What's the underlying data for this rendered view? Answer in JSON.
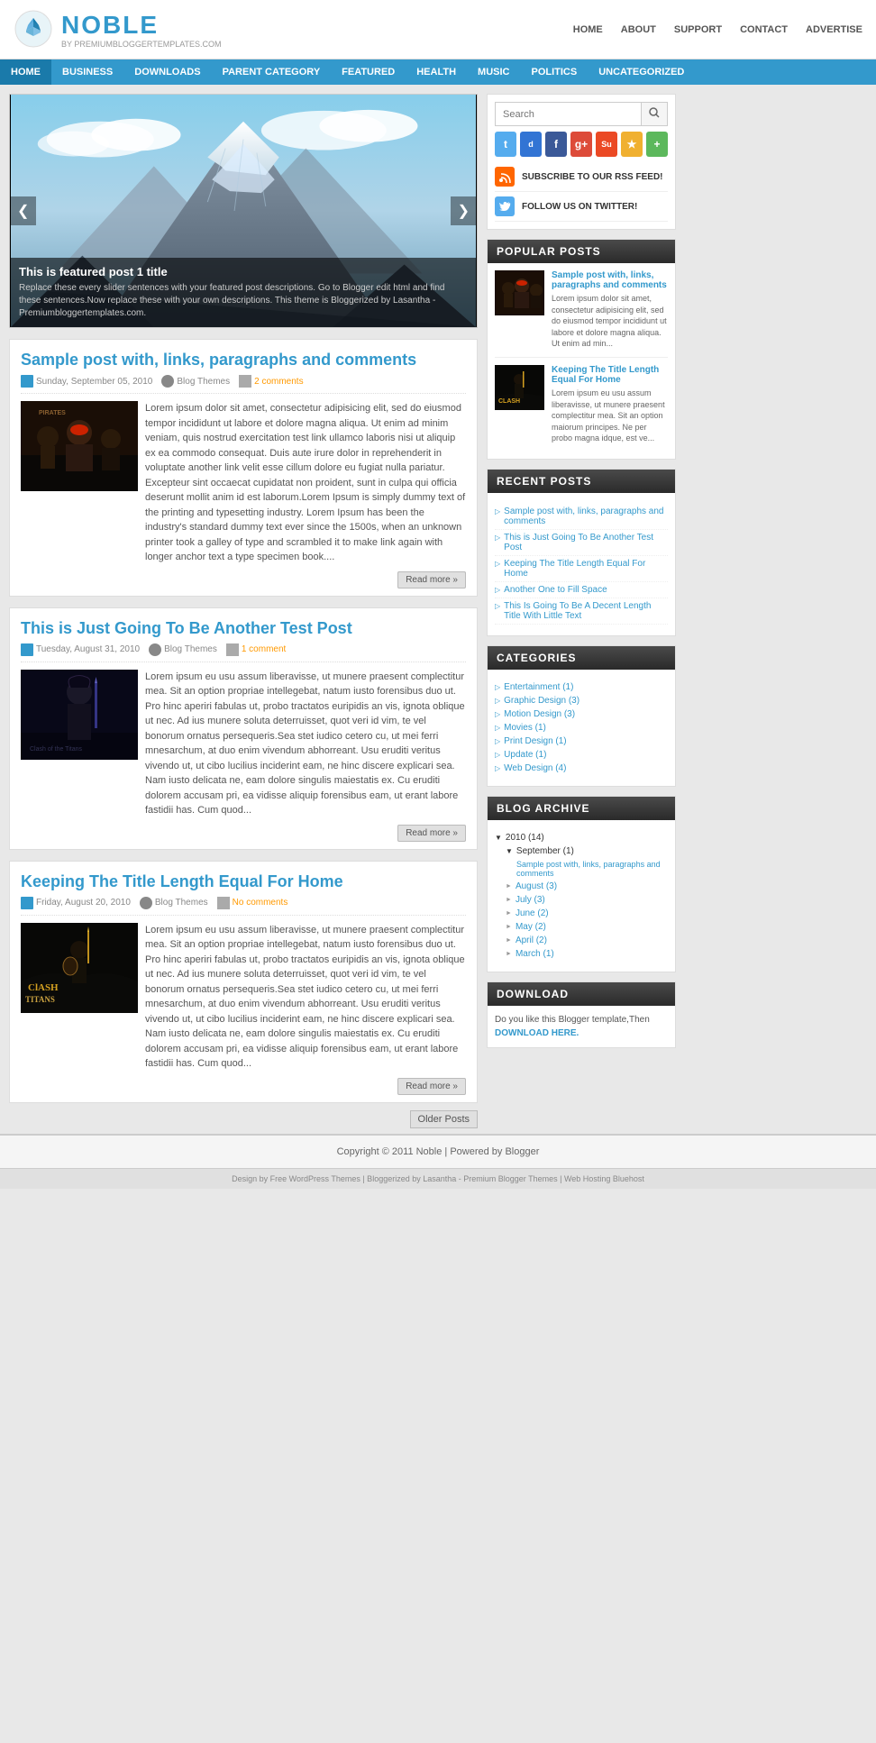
{
  "site": {
    "logo_title": "NOBLE",
    "logo_sub": "BY PREMIUMBLOGGERTEMPLATES.COM",
    "copyright": "Copyright © 2011 Noble | Powered by Blogger",
    "footer_bottom": "Design by Free WordPress Themes | Bloggerized by Lasantha - Premium Blogger Themes | Web Hosting Bluehost"
  },
  "top_nav": {
    "items": [
      {
        "label": "HOME",
        "href": "#"
      },
      {
        "label": "ABOUT",
        "href": "#"
      },
      {
        "label": "SUPPORT",
        "href": "#"
      },
      {
        "label": "CONTACT",
        "href": "#"
      },
      {
        "label": "ADVERTISE",
        "href": "#"
      }
    ]
  },
  "nav_bar": {
    "items": [
      {
        "label": "HOME"
      },
      {
        "label": "BUSINESS"
      },
      {
        "label": "DOWNLOADS"
      },
      {
        "label": "PARENT CATEGORY"
      },
      {
        "label": "FEATURED"
      },
      {
        "label": "HEALTH"
      },
      {
        "label": "MUSIC"
      },
      {
        "label": "POLITICS"
      },
      {
        "label": "UNCATEGORIZED"
      }
    ]
  },
  "slider": {
    "caption_title": "This is featured post 1 title",
    "caption_text": "Replace these every slider sentences with your featured post descriptions. Go to Blogger edit html and find these sentences.Now replace these with your own descriptions. This theme is Bloggerized by Lasantha - Premiumbloggertemplates.com."
  },
  "posts": [
    {
      "id": "post1",
      "title": "Sample post with, links, paragraphs and comments",
      "date": "Sunday, September 05, 2010",
      "author": "Blog Themes",
      "comments": "2 comments",
      "excerpt": "Lorem ipsum dolor sit amet, consectetur adipisicing elit, sed do eiusmod tempor incididunt ut labore et dolore magna aliqua. Ut enim ad minim veniam, quis nostrud exercitation test link ullamco laboris nisi ut aliquip ex ea commodo consequat. Duis aute irure dolor in reprehenderit in voluptate another link velit esse cillum dolore eu fugiat nulla pariatur. Excepteur sint occaecat cupidatat non proident, sunt in culpa qui officia deserunt mollit anim id est laborum.Lorem Ipsum is simply dummy text of the printing and typesetting industry. Lorem Ipsum has been the industry's standard dummy text ever since the 1500s, when an unknown printer took a galley of type and scrambled it to make link again with longer anchor text a type specimen book....",
      "readmore": "Read more »"
    },
    {
      "id": "post2",
      "title": "This is Just Going To Be Another Test Post",
      "date": "Tuesday, August 31, 2010",
      "author": "Blog Themes",
      "comments": "1 comment",
      "excerpt": "Lorem ipsum eu usu assum liberavisse, ut munere praesent complectitur mea. Sit an option propriae intellegebat, natum iusto forensibus duo ut. Pro hinc aperiri fabulas ut, probo tractatos euripidis an vis, ignota oblique ut nec. Ad ius munere soluta deterruisset, quot veri id vim, te vel bonorum ornatus persequeris.Sea stet iudico cetero cu, ut mei ferri mnesarchum, at duo enim vivendum abhorreant. Usu eruditi veritus vivendo ut, ut cibo lucilius inciderint eam, ne hinc discere explicari sea. Nam iusto delicata ne, eam dolore singulis maiestatis ex. Cu eruditi dolorem accusam pri, ea vidisse aliquip forensibus eam, ut erant labore fastidii has. Cum quod...",
      "readmore": "Read more »"
    },
    {
      "id": "post3",
      "title": "Keeping The Title Length Equal For Home",
      "date": "Friday, August 20, 2010",
      "author": "Blog Themes",
      "comments": "No comments",
      "excerpt": "Lorem ipsum eu usu assum liberavisse, ut munere praesent complectitur mea. Sit an option propriae intellegebat, natum iusto forensibus duo ut. Pro hinc aperiri fabulas ut, probo tractatos euripidis an vis, ignota oblique ut nec. Ad ius munere soluta deterruisset, quot veri id vim, te vel bonorum ornatus persequeris.Sea stet iudico cetero cu, ut mei ferri mnesarchum, at duo enim vivendum abhorreant. Usu eruditi veritus vivendo ut, ut cibo lucilius inciderint eam, ne hinc discere explicari sea. Nam iusto delicata ne, eam dolore singulis maiestatis ex. Cu eruditi dolorem accusam pri, ea vidisse aliquip forensibus eam, ut erant labore fastidii has. Cum quod...",
      "readmore": "Read more »"
    }
  ],
  "older_posts": "Older Posts",
  "sidebar": {
    "search_placeholder": "Search",
    "social": {
      "rss_label": "SUBSCRIBE TO OUR RSS FEED!",
      "twitter_label": "FOLLOW US ON TWITTER!"
    },
    "popular_posts_title": "POPULAR POSTS",
    "popular_posts": [
      {
        "title": "Sample post with, links, paragraphs and comments",
        "excerpt": "Lorem ipsum dolor sit amet, consectetur adipisicing elit, sed do eiusmod tempor incididunt ut labore et dolore magna aliqua. Ut enim ad min..."
      },
      {
        "title": "Keeping The Title Length Equal For Home",
        "excerpt": "Lorem ipsum eu usu assum liberavisse, ut munere praesent complectitur mea. Sit an option maiorum principes. Ne per probo magna idque, est ve..."
      }
    ],
    "recent_posts_title": "RECENT POSTS",
    "recent_posts": [
      {
        "label": "Sample post with, links, paragraphs and comments"
      },
      {
        "label": "This is Just Going To Be Another Test Post"
      },
      {
        "label": "Keeping The Title Length Equal For Home"
      },
      {
        "label": "Another One to Fill Space"
      },
      {
        "label": "This Is Going To Be A Decent Length Title With Little Text"
      }
    ],
    "categories_title": "CATEGORIES",
    "categories": [
      {
        "label": "Entertainment",
        "count": "(1)"
      },
      {
        "label": "Graphic Design",
        "count": "(3)"
      },
      {
        "label": "Motion Design",
        "count": "(3)"
      },
      {
        "label": "Movies",
        "count": "(1)"
      },
      {
        "label": "Print Design",
        "count": "(1)"
      },
      {
        "label": "Update",
        "count": "(1)"
      },
      {
        "label": "Web Design",
        "count": "(4)"
      }
    ],
    "archive_title": "BLOG ARCHIVE",
    "archive": {
      "year": "2010",
      "year_count": "(14)",
      "months": [
        {
          "label": "September",
          "count": "(1)",
          "sub": [
            "Sample post with, links, paragraphs and comments"
          ]
        },
        {
          "label": "August",
          "count": "(3)",
          "sub": []
        },
        {
          "label": "July",
          "count": "(3)",
          "sub": []
        },
        {
          "label": "June",
          "count": "(2)",
          "sub": []
        },
        {
          "label": "May",
          "count": "(2)",
          "sub": []
        },
        {
          "label": "April",
          "count": "(2)",
          "sub": []
        },
        {
          "label": "March",
          "count": "(1)",
          "sub": []
        }
      ]
    },
    "download_title": "DOWNLOAD",
    "download_text": "Do you like this Blogger template,Then",
    "download_link_label": "DOWNLOAD HERE."
  }
}
